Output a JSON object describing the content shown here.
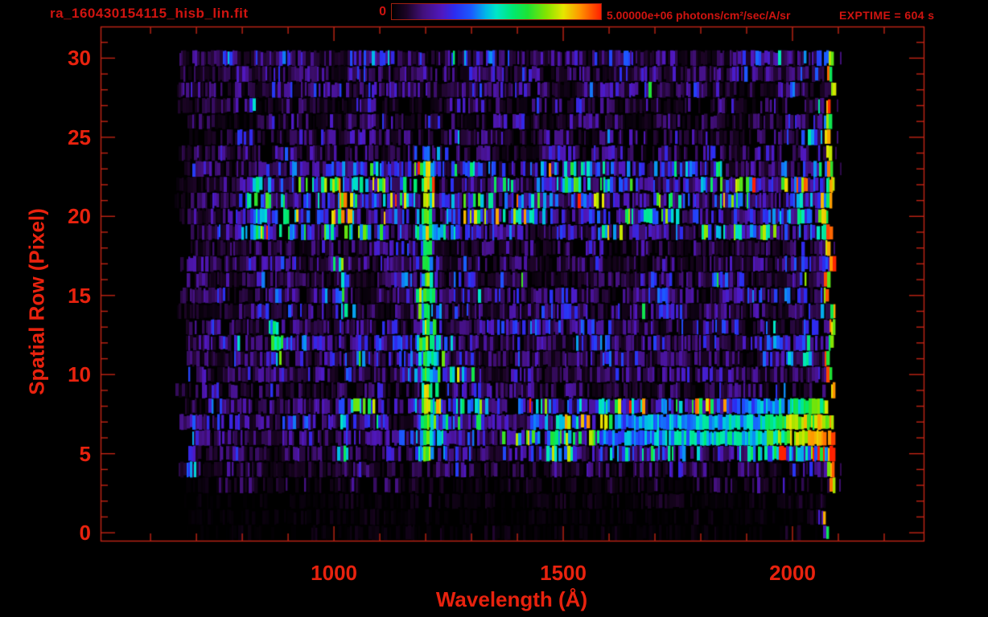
{
  "figure": {
    "title": "ra_160430154115_hisb_lin.fit",
    "exptime_label": "EXPTIME = 604 s",
    "colorbar": {
      "min_label": "0",
      "max_label": "5.00000e+06 photons/cm²/sec/A/sr"
    },
    "colors": {
      "background": "#000000",
      "title_red": "#cf1410",
      "label_red": "#e8220e",
      "axis_line_red": "#c22414"
    }
  },
  "chart_data": {
    "type": "heatmap",
    "title": "ra_160430154115_hisb_lin.fit",
    "xlabel": "Wavelength (Å)",
    "ylabel": "Spatial Row (Pixel)",
    "x_ticks_major": [
      1000,
      1500,
      2000
    ],
    "x_minor_ticks": {
      "start": 600,
      "end": 2200,
      "step": 100
    },
    "y_ticks_major": [
      0,
      5,
      10,
      15,
      20,
      25,
      30
    ],
    "y_minor_ticks": {
      "start": 0,
      "end": 31,
      "step": 1
    },
    "xlim": [
      491,
      2286
    ],
    "ylim": [
      -0.5,
      32.0
    ],
    "data_extent": {
      "wavelength_A": [
        650,
        2095
      ],
      "rows": [
        0,
        30
      ]
    },
    "colorbar_range_photons": [
      0,
      5000000
    ],
    "intensity_units": "photons/cm²/sec/A/sr",
    "exposure_s": 604,
    "colormap_stops": [
      [
        0.0,
        "#000000"
      ],
      [
        0.07,
        "#1c0426"
      ],
      [
        0.15,
        "#43107c"
      ],
      [
        0.24,
        "#5018c0"
      ],
      [
        0.3,
        "#2c2cf0"
      ],
      [
        0.38,
        "#1b5aff"
      ],
      [
        0.45,
        "#00b8e8"
      ],
      [
        0.5,
        "#00e6c8"
      ],
      [
        0.58,
        "#00e870"
      ],
      [
        0.65,
        "#1ee234"
      ],
      [
        0.74,
        "#86e400"
      ],
      [
        0.82,
        "#e6e600"
      ],
      [
        0.9,
        "#ff9400"
      ],
      [
        1.0,
        "#ff2000"
      ]
    ],
    "render": {
      "seed": 20160430,
      "row_base": [
        0.02,
        0.02,
        0.03,
        0.06,
        0.1,
        0.14,
        0.16,
        0.16,
        0.15,
        0.12,
        0.13,
        0.15,
        0.16,
        0.15,
        0.14,
        0.15,
        0.14,
        0.13,
        0.12,
        0.3,
        0.36,
        0.31,
        0.35,
        0.26,
        0.12,
        0.12,
        0.11,
        0.12,
        0.13,
        0.14,
        0.16
      ],
      "band_left_ramp": {
        "rows": [
          19,
          23
        ],
        "lambda_start": 790,
        "width": 110,
        "floor": 0.13
      },
      "lower_band": {
        "rows": [
          5,
          8
        ],
        "weights": [
          0.6,
          1.0,
          0.95,
          0.7
        ],
        "step_amp": 0.16,
        "step_start": 1140,
        "step_width": 80,
        "ramp_amp": 0.3,
        "ramp_start": 1250,
        "ramp_width": 700
      },
      "vlines": [
        {
          "name": "lyman-alpha-emission",
          "lambda": 1203,
          "sigma": 8,
          "amp": 0.48,
          "wing_sigma": 22,
          "wing_amp": 0.15,
          "rows": [
            4.6,
            24.2
          ],
          "row_boost": {
            "9": 0.12,
            "12": 0.14,
            "13": 0.1,
            "21": 0.05,
            "22": 0.07,
            "23": 0.04,
            "24": -0.25
          }
        },
        {
          "name": "faint-column-693",
          "lambda": 693,
          "sigma": 4,
          "amp": 0.13,
          "rows": [
            4,
            30.5
          ]
        },
        {
          "name": "faint-column-1020",
          "lambda": 1020,
          "sigma": 6,
          "amp": 0.16,
          "rows": [
            5,
            23.5
          ]
        }
      ],
      "blobs": [
        {
          "rows": [
            12.6,
            13.5
          ],
          "lambda": [
            856,
            882
          ],
          "amp": 0.42
        },
        {
          "rows": [
            11.6,
            12.5
          ],
          "lambda": [
            864,
            892
          ],
          "amp": 0.5
        },
        {
          "rows": [
            10.6,
            11.5
          ],
          "lambda": [
            858,
            884
          ],
          "amp": 0.26
        },
        {
          "rows": [
            18.6,
            22.4
          ],
          "lambda": [
            800,
            868
          ],
          "amp": 0.17
        },
        {
          "rows": [
            9.6,
            11.4
          ],
          "lambda": [
            1222,
            1305
          ],
          "amp": 0.2
        },
        {
          "rows": [
            7.6,
            8.5
          ],
          "lambda": [
            1005,
            1150
          ],
          "amp": 0.16
        },
        {
          "rows": [
            3.6,
            5.4
          ],
          "lambda": [
            652,
            700
          ],
          "amp": 0.15
        },
        {
          "rows": [
            -0.4,
            1.4
          ],
          "lambda": [
            2055,
            2080
          ],
          "amp": 0.28
        }
      ],
      "envelope": {
        "left_fade": {
          "start": 648,
          "end": 790,
          "min": 0.55
        },
        "right_boost": {
          "start": 1930,
          "end": 2075,
          "max": 1.75
        }
      },
      "data_lambda": {
        "start_min": 648,
        "start_jitter": 40,
        "end_min": 2076,
        "end_jitter": 18
      },
      "edge_spark": {
        "width": 8,
        "v_min": 0.6,
        "v_span": 0.42
      },
      "gap_probs": {
        "low": 0.45,
        "mid": 0.3,
        "high": 0.15,
        "low_threshold": 0.08,
        "mid_threshold": 0.125
      }
    }
  }
}
